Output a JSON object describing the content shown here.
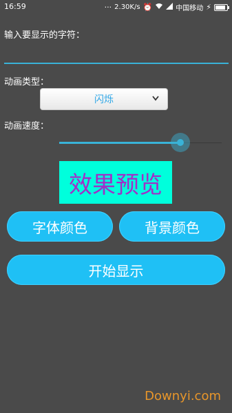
{
  "status_bar": {
    "time": "16:59",
    "speed": "2.30K/s",
    "carrier": "中国移动",
    "icons": [
      "more-icon",
      "alarm-icon",
      "wifi-icon",
      "signal-icon",
      "charging-icon",
      "battery-icon"
    ]
  },
  "labels": {
    "chars": "输入要显示的字符：",
    "anim_type": "动画类型：",
    "anim_speed": "动画速度："
  },
  "input": {
    "value": "",
    "placeholder": ""
  },
  "spinner": {
    "selected": "闪烁"
  },
  "slider": {
    "value_fraction": 0.75
  },
  "preview": {
    "text": "效果预览",
    "bg_color": "#00ffdc",
    "text_color": "#a030c8"
  },
  "buttons": {
    "font_color": "字体颜色",
    "bg_color": "背景颜色",
    "start": "开始显示"
  },
  "watermark": "Downyi.com",
  "colors": {
    "accent": "#39b3d8",
    "button": "#1fc0f5",
    "background": "#4a4a4a"
  }
}
